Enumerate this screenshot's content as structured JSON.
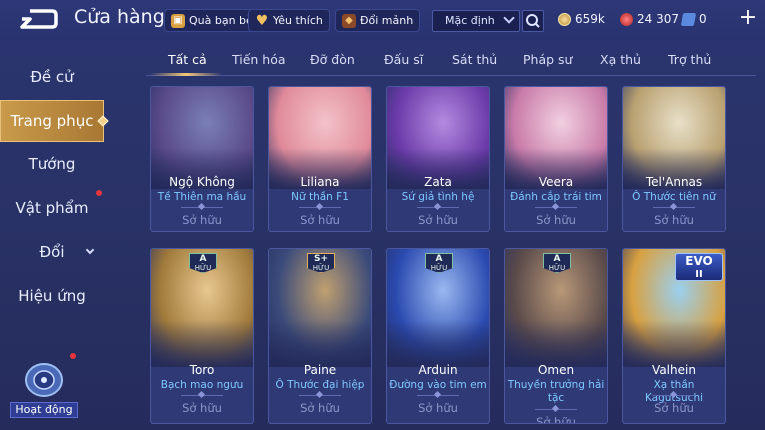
{
  "header": {
    "title": "Cửa hàng",
    "gift_friend": "Quà bạn bè",
    "favorites": "Yêu thích",
    "exchange": "Đổi mảnh",
    "sort_value": "Mặc định",
    "gold": "659k",
    "gems": "24 307",
    "vouchers": "0"
  },
  "sidebar": {
    "items": [
      {
        "label": "Đề cử"
      },
      {
        "label": "Trang phục"
      },
      {
        "label": "Tướng"
      },
      {
        "label": "Vật phẩm"
      },
      {
        "label": "Đổi"
      },
      {
        "label": "Hiệu ứng"
      }
    ],
    "activity_label": "Hoạt động"
  },
  "tabs": [
    {
      "label": "Tất cả"
    },
    {
      "label": "Tiến hóa"
    },
    {
      "label": "Đỡ đòn"
    },
    {
      "label": "Đấu sĩ"
    },
    {
      "label": "Sát thủ"
    },
    {
      "label": "Pháp sư"
    },
    {
      "label": "Xạ thủ"
    },
    {
      "label": "Trợ thủ"
    }
  ],
  "cards": [
    {
      "hero": "Ngộ Không",
      "skin": "Tề Thiên ma hầu",
      "status": "Sở hữu",
      "c1": "#5a4a8a",
      "c2": "#7a7fb8"
    },
    {
      "hero": "Liliana",
      "skin": "Nữ thần F1",
      "status": "Sở hữu",
      "c1": "#e08a9a",
      "c2": "#f3c2c8"
    },
    {
      "hero": "Zata",
      "skin": "Sứ giả tình hệ",
      "status": "Sở hữu",
      "c1": "#6a3aa8",
      "c2": "#b48ae0"
    },
    {
      "hero": "Veera",
      "skin": "Đánh cắp trái tim",
      "status": "Sở hữu",
      "c1": "#c87aa8",
      "c2": "#f2d0e0"
    },
    {
      "hero": "Tel'Annas",
      "skin": "Ô Thước tiên nữ",
      "status": "Sở hữu",
      "c1": "#b8a070",
      "c2": "#e8e0c8"
    },
    {
      "hero": "Toro",
      "skin": "Bạch mao ngưu",
      "status": "Sở hữu",
      "badge": "A",
      "badge_text": "HỮU HẠN",
      "c1": "#a07a3a",
      "c2": "#e8c890"
    },
    {
      "hero": "Paine",
      "skin": "Ô Thước đại hiệp",
      "status": "Sở hữu",
      "badge": "S+",
      "badge_text": "HỮU HẠN",
      "c1": "#3a4a7a",
      "c2": "#c0a070"
    },
    {
      "hero": "Arduin",
      "skin": "Đường vào tim em",
      "status": "Sở hữu",
      "badge": "A",
      "badge_text": "HỮU HẠN",
      "c1": "#2a4ab0",
      "c2": "#9ab8f0"
    },
    {
      "hero": "Omen",
      "skin": "Thuyền trưởng hải tặc",
      "status": "Sở hữu",
      "badge": "A",
      "badge_text": "HỮU HẠN",
      "c1": "#5a4a4a",
      "c2": "#b89878"
    },
    {
      "hero": "Valhein",
      "skin": "Xạ thần Kagutsuchi",
      "status": "Sở hữu",
      "evo": "EVO",
      "evo_level": "II",
      "c1": "#d8a040",
      "c2": "#9ad0f0"
    }
  ]
}
